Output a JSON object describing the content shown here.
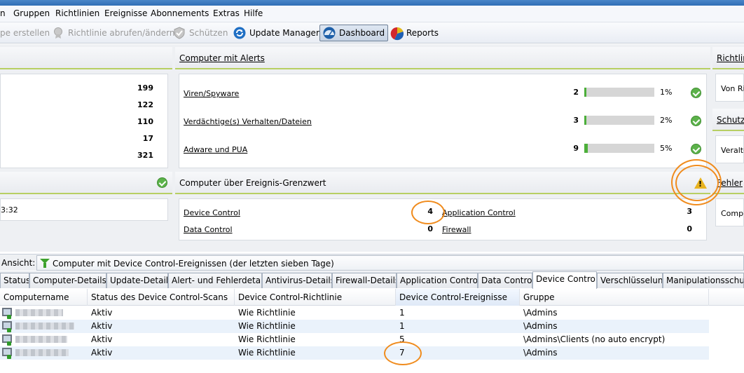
{
  "menu": [
    "n",
    "Gruppen",
    "Richtlinien",
    "Ereignisse",
    "Abonnements",
    "Extras",
    "Hilfe"
  ],
  "toolbar": {
    "create_group": "pe erstellen",
    "policy": "Richtlinie abrufen/ändern",
    "protect": "Schützen",
    "update_manager": "Update Manager",
    "dashboard": "Dashboard",
    "reports": "Reports"
  },
  "left_panel": {
    "numbers": [
      "199",
      "122",
      "110",
      "17",
      "321"
    ],
    "time_fragment": "3:32"
  },
  "alerts_panel": {
    "title": "Computer mit Alerts",
    "rows": [
      {
        "label": "Viren/Spyware",
        "count": "2",
        "pct": "1%",
        "fraction": 0.01
      },
      {
        "label": "Verdächtige(s) Verhalten/Dateien",
        "count": "3",
        "pct": "2%",
        "fraction": 0.02
      },
      {
        "label": "Adware und PUA",
        "count": "9",
        "pct": "5%",
        "fraction": 0.05
      }
    ]
  },
  "threshold_panel": {
    "title": "Computer über Ereignis-Grenzwert",
    "items": [
      {
        "label": "Device Control",
        "count": "4"
      },
      {
        "label": "Data Control",
        "count": "0"
      },
      {
        "label": "Application Control",
        "count": "3"
      },
      {
        "label": "Firewall",
        "count": "0"
      }
    ]
  },
  "right_panel": {
    "head1": "Richtlin",
    "body1": "Von Ri",
    "head2": "Schutz",
    "body2": "Veralte",
    "head3": "Fehler",
    "body3": "Compu"
  },
  "view": {
    "label": "Ansicht:",
    "value": "Computer mit Device Control-Ereignissen (der letzten sieben Tage)"
  },
  "tabs": [
    "Status",
    "Computer-Details",
    "Update-Details",
    "Alert- und Fehlerdetails",
    "Antivirus-Details",
    "Firewall-Details",
    "Application Control",
    "Data Control",
    "Device Control",
    "Verschlüsselung",
    "Manipulationsschutz"
  ],
  "selected_tab": "Device Control",
  "grid": {
    "columns": [
      "Computername",
      "Status des Device Control-Scans",
      "Device Control-Richtlinie",
      "Device Control-Ereignisse",
      "Gruppe"
    ],
    "rows": [
      {
        "status": "Aktiv",
        "policy": "Wie Richtlinie",
        "events": "1",
        "group": "\\Admins"
      },
      {
        "status": "Aktiv",
        "policy": "Wie Richtlinie",
        "events": "1",
        "group": "\\Admins"
      },
      {
        "status": "Aktiv",
        "policy": "Wie Richtlinie",
        "events": "5",
        "group": "\\Admins\\Clients (no auto encrypt)"
      },
      {
        "status": "Aktiv",
        "policy": "Wie Richtlinie",
        "events": "7",
        "group": "\\Admins"
      }
    ]
  },
  "colors": {
    "accent_green": "#b7cf63",
    "highlight_ring": "#f08c1e",
    "warning": "#e8b320"
  }
}
